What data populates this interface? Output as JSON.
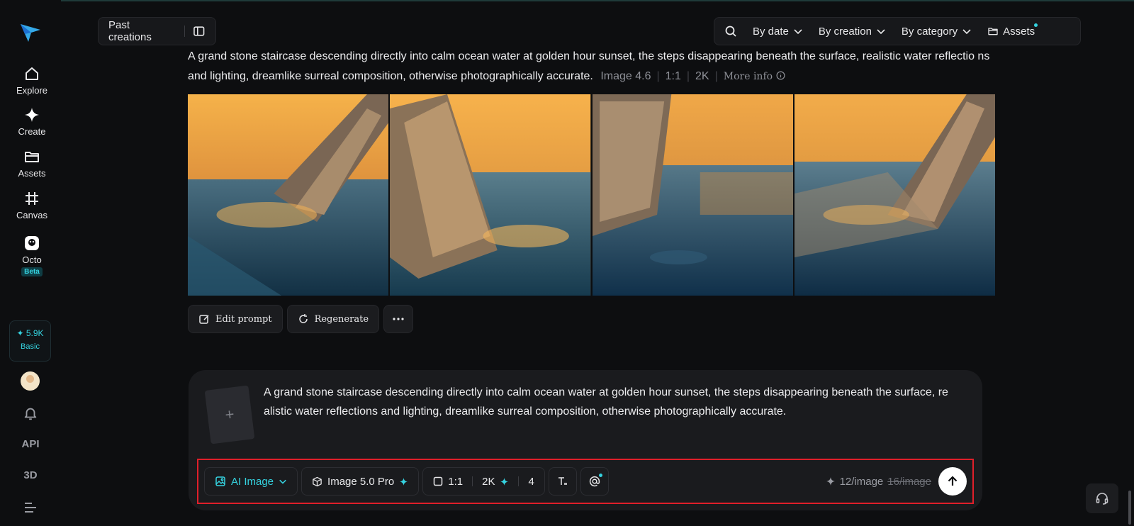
{
  "sidebar": {
    "items": [
      {
        "label": "Explore",
        "icon": "home-icon"
      },
      {
        "label": "Create",
        "icon": "sparkle-icon"
      },
      {
        "label": "Assets",
        "icon": "folder-icon"
      },
      {
        "label": "Canvas",
        "icon": "canvas-icon"
      },
      {
        "label": "Octo",
        "icon": "octo-icon",
        "badge": "Beta"
      }
    ],
    "credits": {
      "amount": "5.9K",
      "tier": "Basic"
    },
    "api_label": "API",
    "threed_label": "3D"
  },
  "header": {
    "past_creations": "Past creations",
    "filters": [
      "By date",
      "By creation",
      "By category"
    ],
    "assets": "Assets"
  },
  "result": {
    "prompt": "A grand stone staircase descending directly into calm ocean water at golden hour sunset, the steps disappearing beneath the surface, realistic water reflectio ns and lighting, dreamlike surreal composition, otherwise photographically accurate.",
    "model": "Image 4.6",
    "ratio": "1:1",
    "resolution": "2K",
    "more_info": "More info",
    "images": [
      "Generated image 1",
      "Generated image 2",
      "Generated image 3",
      "Generated image 4"
    ],
    "actions": {
      "edit": "Edit prompt",
      "regenerate": "Regenerate"
    }
  },
  "composer": {
    "prompt": "A grand stone staircase descending directly into calm ocean water at golden hour sunset, the steps disappearing beneath the surface, re alistic water reflections and lighting, dreamlike surreal composition, otherwise photographically accurate.",
    "mode": "AI Image",
    "model": "Image 5.0 Pro",
    "ratio": "1:1",
    "resolution": "2K",
    "count": "4",
    "price": "12/image",
    "old_price": "16/image"
  },
  "colors": {
    "accent": "#35d3e0",
    "highlight_border": "#e01f2a",
    "background": "#0d0e10"
  }
}
